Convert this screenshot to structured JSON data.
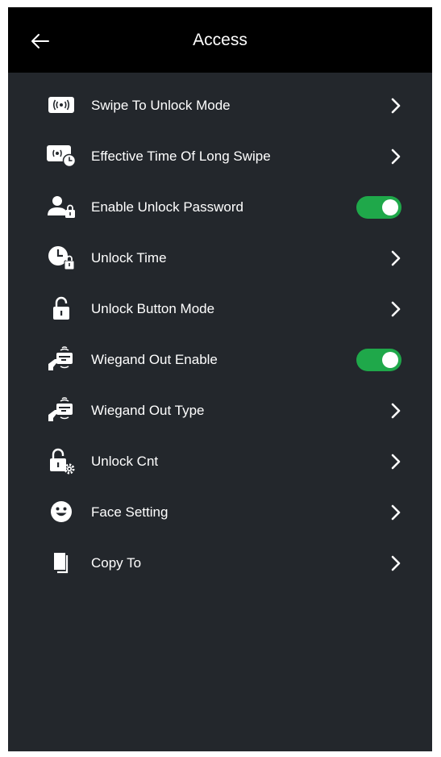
{
  "header": {
    "title": "Access",
    "back_icon": "arrow-left-icon"
  },
  "colors": {
    "background": "#23272c",
    "header": "#000000",
    "toggle_on": "#1fa84a",
    "text": "#ffffff"
  },
  "items": [
    {
      "label": "Swipe To Unlock Mode",
      "icon": "card-swipe-icon",
      "control": "chevron"
    },
    {
      "label": "Effective Time Of Long Swipe",
      "icon": "card-swipe-clock-icon",
      "control": "chevron"
    },
    {
      "label": "Enable Unlock Password",
      "icon": "user-lock-icon",
      "control": "toggle",
      "enabled": true
    },
    {
      "label": "Unlock Time",
      "icon": "clock-lock-icon",
      "control": "chevron"
    },
    {
      "label": "Unlock Button Mode",
      "icon": "padlock-open-icon",
      "control": "chevron"
    },
    {
      "label": "Wiegand Out Enable",
      "icon": "wiegand-card-icon",
      "control": "toggle",
      "enabled": true
    },
    {
      "label": "Wiegand Out Type",
      "icon": "wiegand-card-icon",
      "control": "chevron"
    },
    {
      "label": "Unlock Cnt",
      "icon": "lock-gear-icon",
      "control": "chevron"
    },
    {
      "label": "Face Setting",
      "icon": "face-icon",
      "control": "chevron"
    },
    {
      "label": "Copy To",
      "icon": "copy-icon",
      "control": "chevron"
    }
  ]
}
